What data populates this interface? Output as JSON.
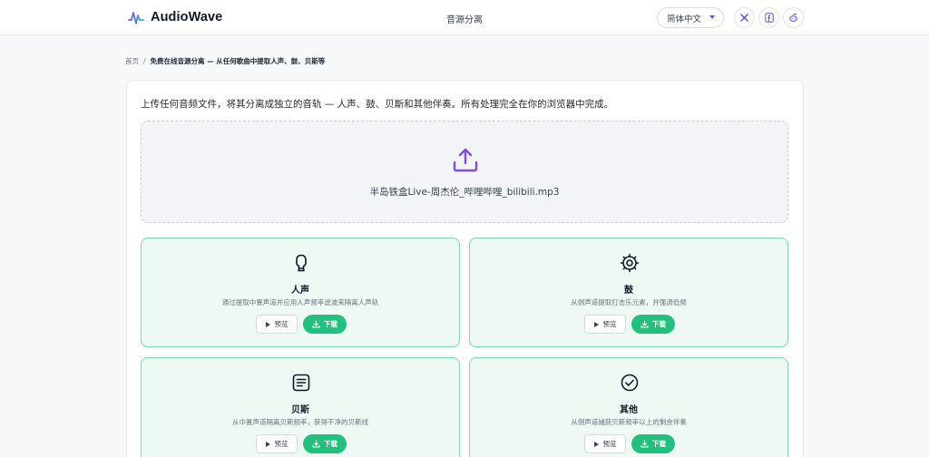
{
  "header": {
    "brand": "AudioWave",
    "nav_title": "音源分离",
    "language": "简体中文",
    "icons": [
      "audiowave-logo-icon",
      "x-icon",
      "facebook-icon",
      "reddit-icon"
    ]
  },
  "breadcrumb": {
    "home": "首页",
    "separator": "/",
    "current": "免费在线音源分离 — 从任何歌曲中提取人声、鼓、贝斯等"
  },
  "main": {
    "intro": "上传任何音频文件，将其分离成独立的音轨 — 人声、鼓、贝斯和其他伴奏。所有处理完全在你的浏览器中完成。",
    "upload_icon": "upload-icon",
    "file_name": "半岛铁盒Live-周杰伦_哔哩哔哩_bilibili.mp3"
  },
  "tracks": [
    {
      "name": "人声",
      "desc": "通过提取中置声道并应用人声频率滤波来隔离人声轨",
      "icon": "microphone-icon",
      "preview": "预览",
      "download": "下载"
    },
    {
      "name": "鼓",
      "desc": "从侧声道提取打击乐元素，并强调低频",
      "icon": "drum-icon",
      "preview": "预览",
      "download": "下载"
    },
    {
      "name": "贝斯",
      "desc": "从中置声道隔离贝斯频率，获得干净的贝斯线",
      "icon": "bass-icon",
      "preview": "预览",
      "download": "下载"
    },
    {
      "name": "其他",
      "desc": "从侧声道捕获贝斯频率以上的剩余伴奏",
      "icon": "check-circle-icon",
      "preview": "预览",
      "download": "下载"
    }
  ],
  "colors": {
    "accent_purple": "#7c4ddf",
    "accent_green": "#22c07e",
    "track_bg": "#eef9f3",
    "track_border": "#7fd6a9"
  }
}
